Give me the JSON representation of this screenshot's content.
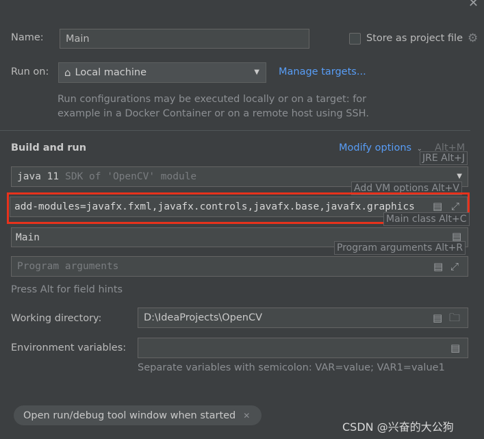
{
  "name": {
    "label": "Name:",
    "value": "Main"
  },
  "store_as_project_file": {
    "label": "Store as project file",
    "checked": false
  },
  "run_on": {
    "label": "Run on:",
    "value": "Local machine",
    "manage_link": "Manage targets..."
  },
  "run_on_help": {
    "line1": "Run configurations may be executed locally or on a target: for",
    "line2": "example in a Docker Container or on a remote host using SSH."
  },
  "build_and_run": {
    "title": "Build and run",
    "modify_options": "Modify options",
    "modify_shortcut": "Alt+M",
    "jre_value": "java 11",
    "jre_suffix": "SDK of 'OpenCV' module",
    "vm_options_value": "add-modules=javafx.fxml,javafx.controls,javafx.base,javafx.graphics",
    "main_class_value": "Main",
    "program_args_placeholder": "Program arguments",
    "field_hints_note": "Press Alt for field hints"
  },
  "field_hints": {
    "jre": "JRE Alt+J",
    "vm_options": "Add VM options Alt+V",
    "main_class": "Main class Alt+C",
    "program_args": "Program arguments Alt+R"
  },
  "working_directory": {
    "label": "Working directory:",
    "value": "D:\\IdeaProjects\\OpenCV"
  },
  "environment_variables": {
    "label": "Environment variables:",
    "value": "",
    "help": "Separate variables with semicolon: VAR=value; VAR1=value1"
  },
  "tool_window_chip": "Open run/debug tool window when started",
  "watermark": "CSDN @兴奋的大公狗",
  "highlight_color": "#e8321c",
  "link_color": "#589df6"
}
